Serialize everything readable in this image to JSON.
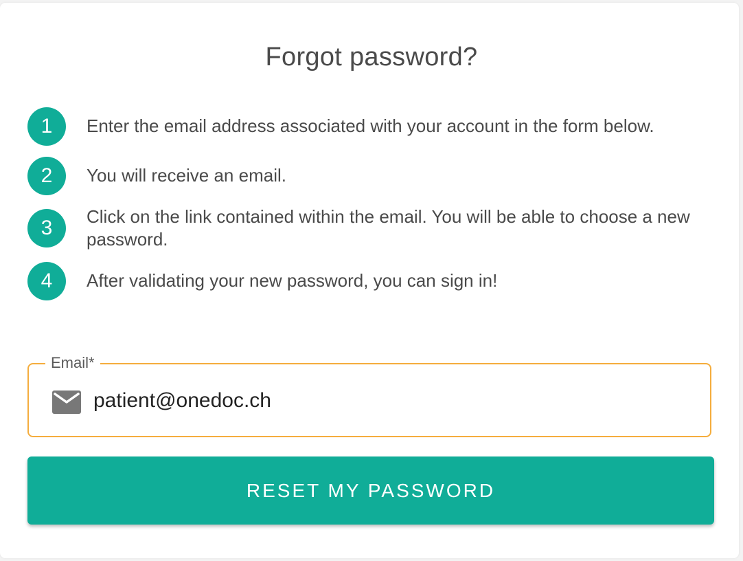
{
  "title": "Forgot password?",
  "steps": [
    {
      "number": "1",
      "text": "Enter the email address associated with your account in the form below."
    },
    {
      "number": "2",
      "text": "You will receive an email."
    },
    {
      "number": "3",
      "text": "Click on the link contained within the email. You will be able to choose a new password."
    },
    {
      "number": "4",
      "text": "After validating your new password, you can sign in!"
    }
  ],
  "email_field": {
    "label": "Email*",
    "value": "patient@onedoc.ch",
    "icon": "mail-icon"
  },
  "reset_button": {
    "label": "RESET MY PASSWORD"
  },
  "colors": {
    "accent": "#10ad98",
    "focus_border": "#f5ad3d",
    "text": "#4a4a4a"
  }
}
